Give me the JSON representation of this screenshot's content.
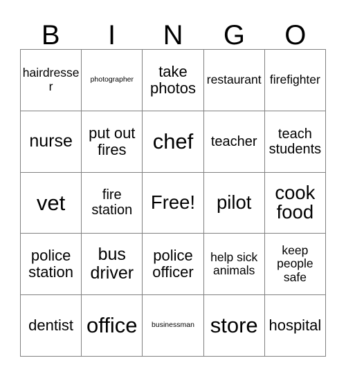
{
  "card": {
    "title": "BINGO card",
    "header_letters": [
      "B",
      "I",
      "N",
      "G",
      "O"
    ],
    "border_color": "#808080",
    "background_color": "#ffffff",
    "text_color": "#000000",
    "columns": 5,
    "rows": 5,
    "free_space_label": "Free!",
    "free_space_index": 12
  },
  "cells": [
    {
      "text": "hairdresser",
      "size": "fs-sm"
    },
    {
      "text": "photographer",
      "size": "fs-xs"
    },
    {
      "text": "take photos",
      "size": "fs-lg"
    },
    {
      "text": "restaurant",
      "size": "fs-sm"
    },
    {
      "text": "firefighter",
      "size": "fs-sm"
    },
    {
      "text": "nurse",
      "size": "fs-xl"
    },
    {
      "text": "put out fires",
      "size": "fs-lg"
    },
    {
      "text": "chef",
      "size": "fs-huge"
    },
    {
      "text": "teacher",
      "size": "fs-md"
    },
    {
      "text": "teach students",
      "size": "fs-md"
    },
    {
      "text": "vet",
      "size": "fs-huge"
    },
    {
      "text": "fire station",
      "size": "fs-md"
    },
    {
      "text": "Free!",
      "size": "fs-xxl"
    },
    {
      "text": "pilot",
      "size": "fs-xxl"
    },
    {
      "text": "cook food",
      "size": "fs-xxl"
    },
    {
      "text": "police station",
      "size": "fs-lg"
    },
    {
      "text": "bus driver",
      "size": "fs-xl"
    },
    {
      "text": "police officer",
      "size": "fs-lg"
    },
    {
      "text": "help sick animals",
      "size": "fs-sm"
    },
    {
      "text": "keep people safe",
      "size": "fs-sm"
    },
    {
      "text": "dentist",
      "size": "fs-lg"
    },
    {
      "text": "office",
      "size": "fs-huge"
    },
    {
      "text": "businessman",
      "size": "fs-xs"
    },
    {
      "text": "store",
      "size": "fs-huge"
    },
    {
      "text": "hospital",
      "size": "fs-lg"
    }
  ]
}
